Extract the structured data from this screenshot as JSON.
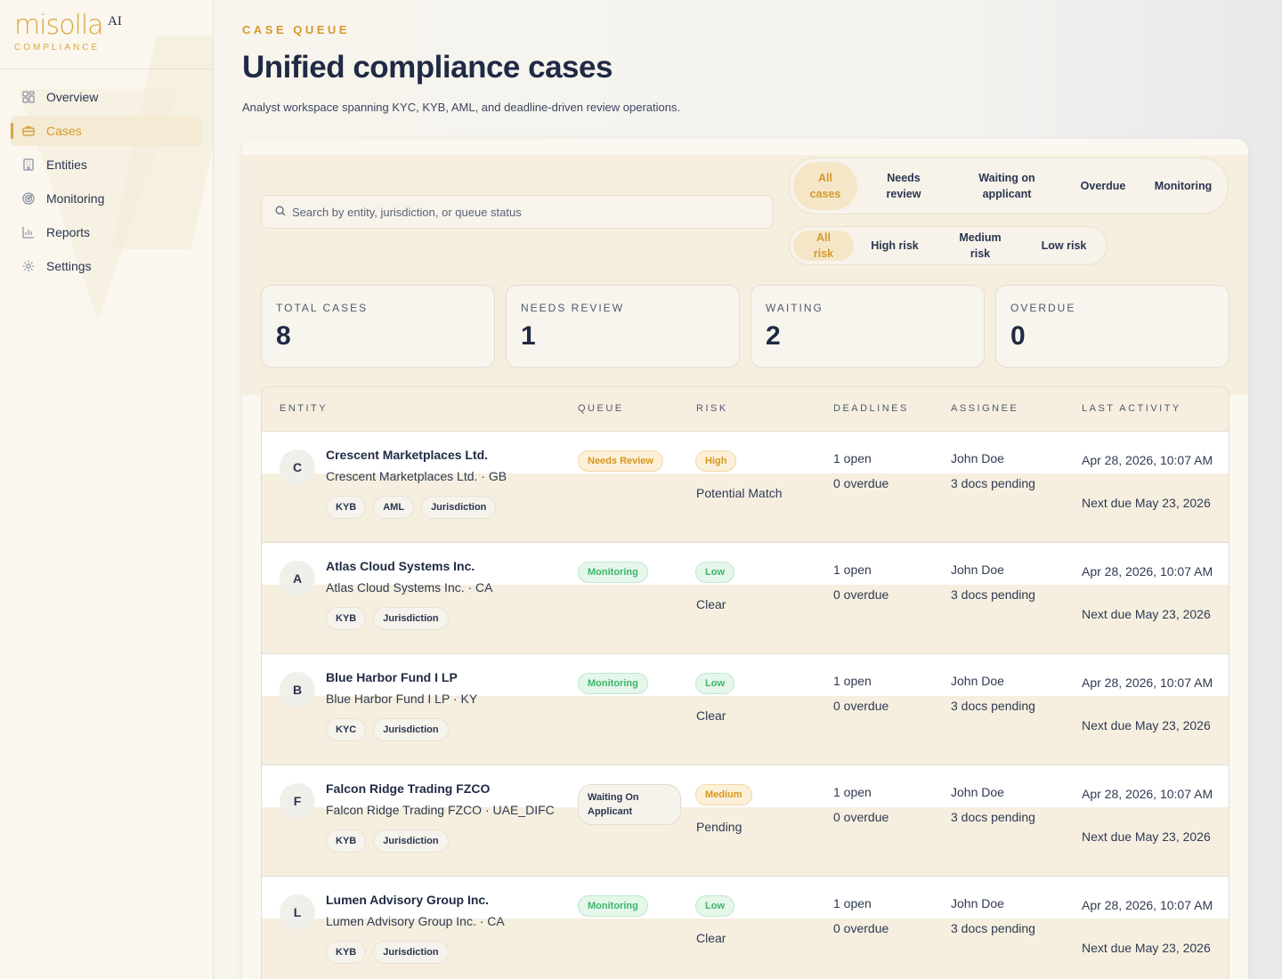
{
  "brand": {
    "logo_word": "misolla",
    "logo_suffix": "AI",
    "logo_sub": "COMPLIANCE",
    "accent": "#d8a640"
  },
  "sidebar": {
    "items": [
      {
        "label": "Overview",
        "icon": "grid-icon",
        "active": false
      },
      {
        "label": "Cases",
        "icon": "briefcase-icon",
        "active": true
      },
      {
        "label": "Entities",
        "icon": "building-icon",
        "active": false
      },
      {
        "label": "Monitoring",
        "icon": "radar-icon",
        "active": false
      },
      {
        "label": "Reports",
        "icon": "bar-chart-icon",
        "active": false
      },
      {
        "label": "Settings",
        "icon": "gear-icon",
        "active": false
      }
    ]
  },
  "header": {
    "eyebrow": "CASE QUEUE",
    "title": "Unified compliance cases",
    "subtitle": "Analyst workspace spanning KYC, KYB, AML, and deadline-driven review operations."
  },
  "search": {
    "placeholder": "Search by entity, jurisdiction, or queue status"
  },
  "queue_filters": [
    "All cases",
    "Needs review",
    "Waiting on applicant",
    "Overdue",
    "Monitoring"
  ],
  "queue_filter_active": "All cases",
  "risk_filters": [
    "All risk",
    "High risk",
    "Medium risk",
    "Low risk"
  ],
  "risk_filter_active": "All risk",
  "stats": [
    {
      "label": "TOTAL CASES",
      "value": "8"
    },
    {
      "label": "NEEDS REVIEW",
      "value": "1"
    },
    {
      "label": "WAITING",
      "value": "2"
    },
    {
      "label": "OVERDUE",
      "value": "0"
    }
  ],
  "table": {
    "columns": [
      "ENTITY",
      "QUEUE",
      "RISK",
      "DEADLINES",
      "ASSIGNEE",
      "LAST ACTIVITY"
    ],
    "rows": [
      {
        "initial": "C",
        "name": "Crescent Marketplaces Ltd.",
        "sub": "Crescent Marketplaces Ltd. · GB",
        "tags": [
          "KYB",
          "AML",
          "Jurisdiction"
        ],
        "queue": "Needs Review",
        "risk": "High",
        "risk_text": "Potential Match",
        "deadline_open": "1 open",
        "deadline_overdue": "0 overdue",
        "assignee": "John Doe",
        "docs": "3 docs pending",
        "last_activity": "Apr 28, 2026, 10:07 AM",
        "next_due": "Next due May 23, 2026"
      },
      {
        "initial": "A",
        "name": "Atlas Cloud Systems Inc.",
        "sub": "Atlas Cloud Systems Inc. · CA",
        "tags": [
          "KYB",
          "Jurisdiction"
        ],
        "queue": "Monitoring",
        "risk": "Low",
        "risk_text": "Clear",
        "deadline_open": "1 open",
        "deadline_overdue": "0 overdue",
        "assignee": "John Doe",
        "docs": "3 docs pending",
        "last_activity": "Apr 28, 2026, 10:07 AM",
        "next_due": "Next due May 23, 2026"
      },
      {
        "initial": "B",
        "name": "Blue Harbor Fund I LP",
        "sub": "Blue Harbor Fund I LP · KY",
        "tags": [
          "KYC",
          "Jurisdiction"
        ],
        "queue": "Monitoring",
        "risk": "Low",
        "risk_text": "Clear",
        "deadline_open": "1 open",
        "deadline_overdue": "0 overdue",
        "assignee": "John Doe",
        "docs": "3 docs pending",
        "last_activity": "Apr 28, 2026, 10:07 AM",
        "next_due": "Next due May 23, 2026"
      },
      {
        "initial": "F",
        "name": "Falcon Ridge Trading FZCO",
        "sub": "Falcon Ridge Trading FZCO · UAE_DIFC",
        "tags": [
          "KYB",
          "Jurisdiction"
        ],
        "queue": "Waiting On Applicant",
        "risk": "Medium",
        "risk_text": "Pending",
        "deadline_open": "1 open",
        "deadline_overdue": "0 overdue",
        "assignee": "John Doe",
        "docs": "3 docs pending",
        "last_activity": "Apr 28, 2026, 10:07 AM",
        "next_due": "Next due May 23, 2026"
      },
      {
        "initial": "L",
        "name": "Lumen Advisory Group Inc.",
        "sub": "Lumen Advisory Group Inc. · CA",
        "tags": [
          "KYB",
          "Jurisdiction"
        ],
        "queue": "Monitoring",
        "risk": "Low",
        "risk_text": "Clear",
        "deadline_open": "1 open",
        "deadline_overdue": "0 overdue",
        "assignee": "John Doe",
        "docs": "3 docs pending",
        "last_activity": "Apr 28, 2026, 10:07 AM",
        "next_due": "Next due May 23, 2026"
      }
    ]
  }
}
